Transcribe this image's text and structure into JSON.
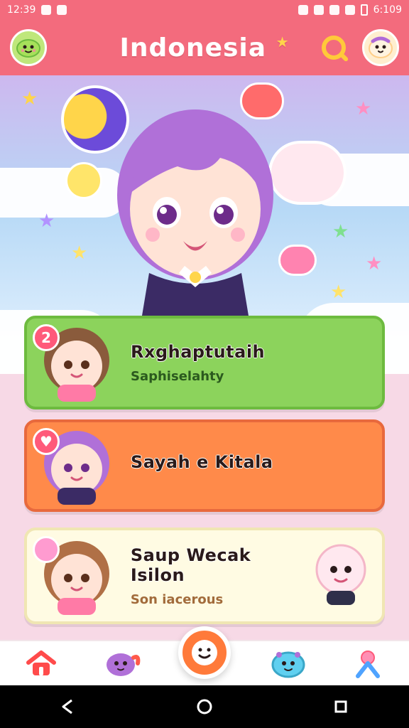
{
  "status_bar": {
    "time": "12:39",
    "battery_text": "6:109"
  },
  "app_bar": {
    "title": "Indonesia",
    "title_star": "★"
  },
  "list": [
    {
      "badge": "2",
      "title": "Rxghaptutaih",
      "subtitle": "Saphiselahty",
      "color": "#8cd35c"
    },
    {
      "badge": "♥",
      "title": "Sayah e Kitala",
      "subtitle": "",
      "color": "#ff8a4a"
    },
    {
      "badge": "",
      "title": "Saup Wecak Isilon",
      "subtitle": "Son iacerous",
      "color": "#fffbe3"
    }
  ],
  "icons": {
    "top_left": "mascot-icon",
    "top_search": "search-icon",
    "top_right": "profile-mascot-icon",
    "nav_home": "home-icon",
    "nav_pet": "pet-icon",
    "nav_center": "smiley-icon",
    "nav_chat": "chat-pet-icon",
    "nav_profile": "profile-icon"
  },
  "colors": {
    "accent": "#f36b7d",
    "gold": "#ffc93a",
    "orange_fab": "#ff7a3a"
  }
}
